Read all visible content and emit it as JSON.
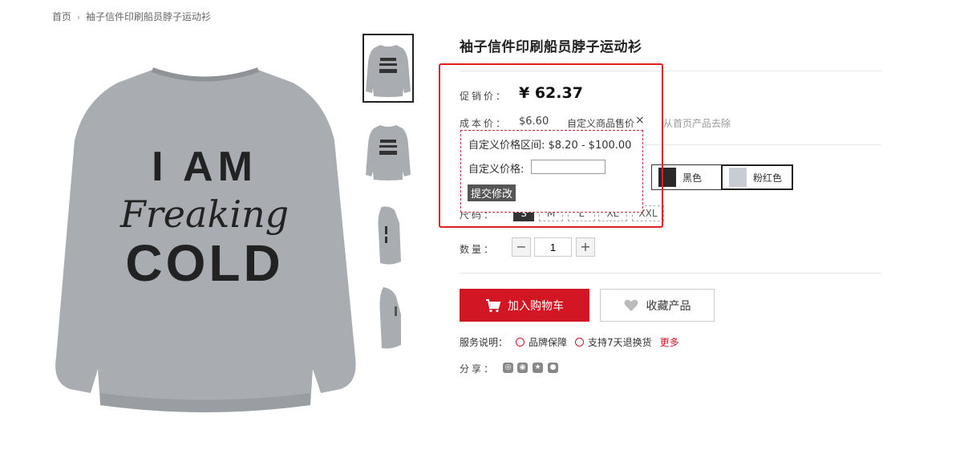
{
  "breadcrumb": {
    "home": "首页",
    "sep": "›",
    "current": "袖子信件印刷船员脖子运动衫"
  },
  "product": {
    "title": "袖子信件印刷船员脖子运动衫",
    "shirt_text": {
      "line1": "I AM",
      "line2": "Freaking",
      "line3": "COLD"
    }
  },
  "price": {
    "promo_label": "促销价：",
    "promo_value": "¥ 62.37",
    "cost_label": "成本价：",
    "cost_value": "$6.60",
    "custom_link": "自定义商品售价",
    "close": "×",
    "remove_link": "从首页产品去除"
  },
  "popup": {
    "range_text": "自定义价格区间: $8.20 - $100.00",
    "custom_label": "自定义价格:",
    "custom_value": "",
    "submit": "提交修改"
  },
  "colors": {
    "options": [
      {
        "label": "黑色",
        "swatch": "#2a2a2a"
      },
      {
        "label": "粉红色",
        "swatch": "#c9ccd2"
      }
    ]
  },
  "size": {
    "label": "尺码：",
    "options": [
      "S",
      "M",
      "L",
      "XL",
      "XXL"
    ],
    "selected": "S"
  },
  "quantity": {
    "label": "数量：",
    "value": "1",
    "minus": "−",
    "plus": "+"
  },
  "actions": {
    "add_cart": "加入购物车",
    "collect": "收藏产品"
  },
  "service": {
    "label": "服务说明：",
    "items": [
      "品牌保障",
      "支持7天退换货"
    ],
    "more": "更多"
  },
  "share": {
    "label": "分享：",
    "icons": [
      "weibo-icon",
      "wechat-icon",
      "qzone-icon",
      "qq-icon"
    ]
  },
  "colors_theme": {
    "accent": "#d31623",
    "frame": "#e02020",
    "shirt": "#a9acb1"
  }
}
